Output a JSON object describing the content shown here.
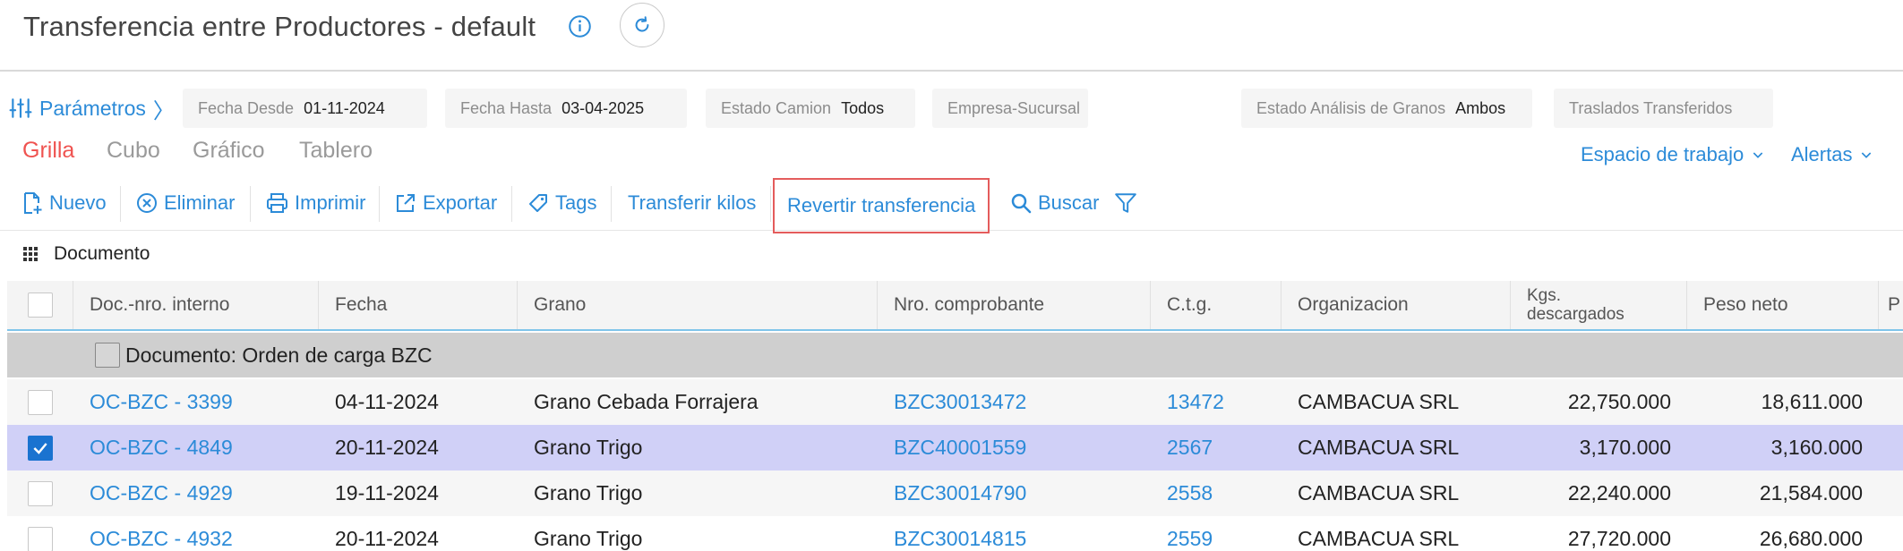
{
  "header": {
    "title": "Transferencia entre Productores - default"
  },
  "params": {
    "label": "Parámetros",
    "filters": [
      {
        "label": "Fecha Desde",
        "value": "01-11-2024"
      },
      {
        "label": "Fecha Hasta",
        "value": "03-04-2025"
      },
      {
        "label": "Estado Camion",
        "value": "Todos"
      },
      {
        "label": "Empresa-Sucursal",
        "value": ""
      },
      {
        "label": "Estado Análisis de Granos",
        "value": "Ambos"
      },
      {
        "label": "Traslados Transferidos",
        "value": ""
      }
    ]
  },
  "tabs": [
    "Grilla",
    "Cubo",
    "Gráfico",
    "Tablero"
  ],
  "workspace": {
    "label": "Espacio de trabajo",
    "alerts": "Alertas"
  },
  "toolbar": {
    "nuevo": "Nuevo",
    "eliminar": "Eliminar",
    "imprimir": "Imprimir",
    "exportar": "Exportar",
    "tags": "Tags",
    "transferir": "Transferir kilos",
    "revertir": "Revertir transferencia",
    "buscar": "Buscar"
  },
  "grouping": {
    "label": "Documento"
  },
  "table": {
    "columns": [
      "Doc.-nro. interno",
      "Fecha",
      "Grano",
      "Nro. comprobante",
      "C.t.g.",
      "Organizacion",
      "Kgs. descargados",
      "Peso neto",
      "P"
    ],
    "group_label": "Documento: Orden de carga BZC",
    "rows": [
      {
        "doc": "OC-BZC - 3399",
        "fecha": "04-11-2024",
        "grano": "Grano Cebada Forrajera",
        "comprobante": "BZC30013472",
        "ctg": "13472",
        "org": "CAMBACUA SRL",
        "kgs": "22,750.000",
        "peso": "18,611.000",
        "selected": false
      },
      {
        "doc": "OC-BZC - 4849",
        "fecha": "20-11-2024",
        "grano": "Grano Trigo",
        "comprobante": "BZC40001559",
        "ctg": "2567",
        "org": "CAMBACUA SRL",
        "kgs": "3,170.000",
        "peso": "3,160.000",
        "selected": true
      },
      {
        "doc": "OC-BZC - 4929",
        "fecha": "19-11-2024",
        "grano": "Grano Trigo",
        "comprobante": "BZC30014790",
        "ctg": "2558",
        "org": "CAMBACUA SRL",
        "kgs": "22,240.000",
        "peso": "21,584.000",
        "selected": false
      },
      {
        "doc": "OC-BZC - 4932",
        "fecha": "20-11-2024",
        "grano": "Grano Trigo",
        "comprobante": "BZC30014815",
        "ctg": "2559",
        "org": "CAMBACUA SRL",
        "kgs": "27,720.000",
        "peso": "26,680.000",
        "selected": false
      }
    ]
  }
}
